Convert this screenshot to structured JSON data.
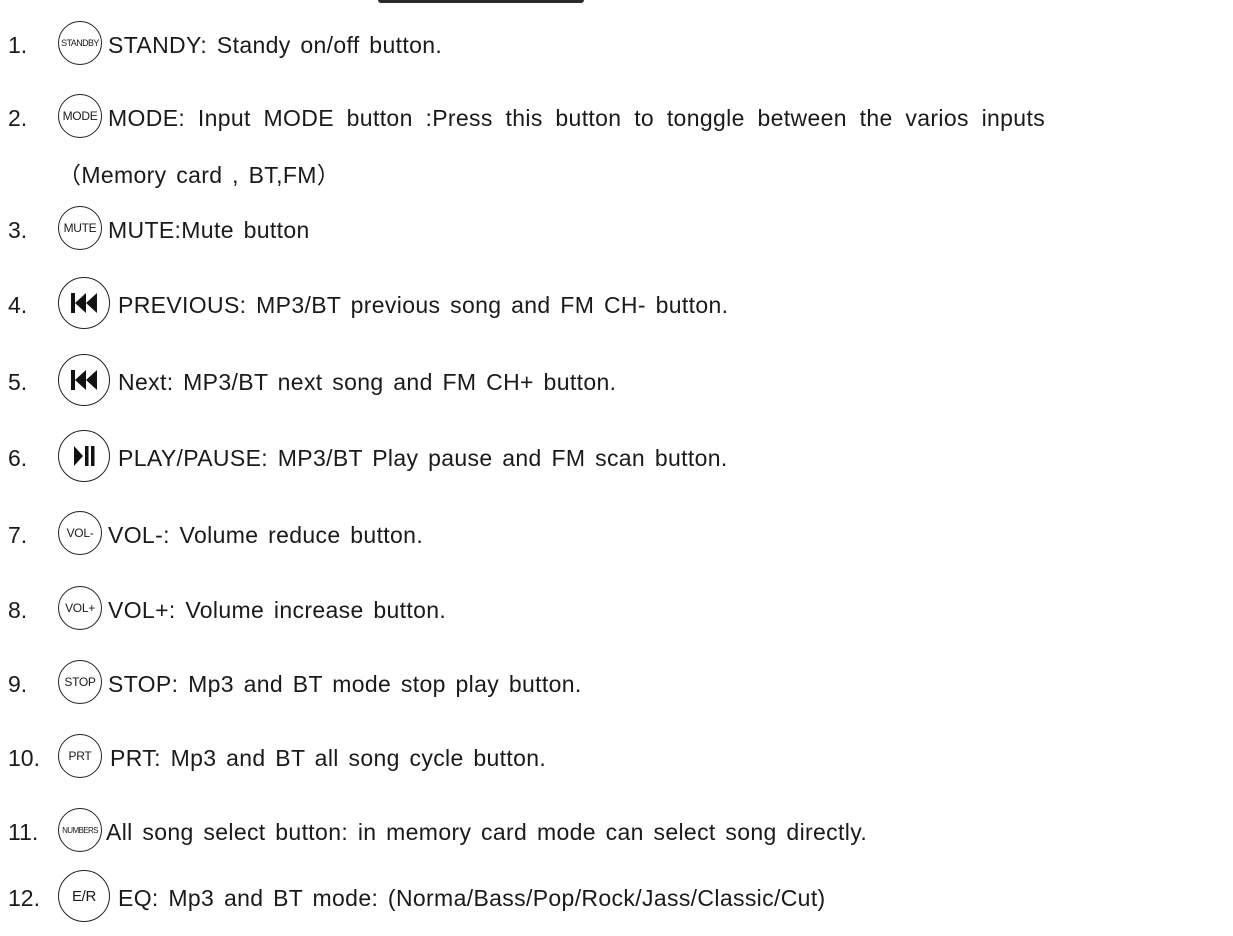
{
  "items": [
    {
      "number": "1.",
      "badge": "STANDBY",
      "text": "STANDY: Standy on/off   button."
    },
    {
      "number": "2.",
      "badge": "MODE",
      "text": "MODE: Input  MODE button :Press  this  button  to tonggle  between  the varios inputs",
      "text2": "（Memory  card , BT,FM）"
    },
    {
      "number": "3.",
      "badge": "MUTE",
      "text": "MUTE:Mute  button"
    },
    {
      "number": "4.",
      "badge_icon": "previous-track-icon",
      "text": "PREVIOUS: MP3/BT previous  song  and  FM  CH-  button."
    },
    {
      "number": "5.",
      "badge_icon": "previous-track-icon",
      "text": "Next: MP3/BT  next  song  and  FM  CH+  button."
    },
    {
      "number": "6.",
      "badge_icon": "play-pause-icon",
      "text": "PLAY/PAUSE: MP3/BT  Play pause  and  FM  scan  button."
    },
    {
      "number": "7.",
      "badge": "VOL-",
      "text": "VOL-: Volume  reduce   button."
    },
    {
      "number": "8.",
      "badge": "VOL+",
      "text": "VOL+: Volume  increase   button."
    },
    {
      "number": "9.",
      "badge": "STOP",
      "text": "STOP: Mp3   and  BT  mode stop play button."
    },
    {
      "number": "10.",
      "badge": "PRT",
      "text": "PRT: Mp3  and  BT   all song cycle  button."
    },
    {
      "number": "11.",
      "badge": "NUMBERS",
      "text": "All  song  select  button: in memory  card  mode  can select  song  directly."
    },
    {
      "number": "12.",
      "badge": "E/R",
      "text": "EQ: Mp3   and  BT  mode: (Norma/Bass/Pop/Rock/Jass/Classic/Cut)"
    }
  ]
}
